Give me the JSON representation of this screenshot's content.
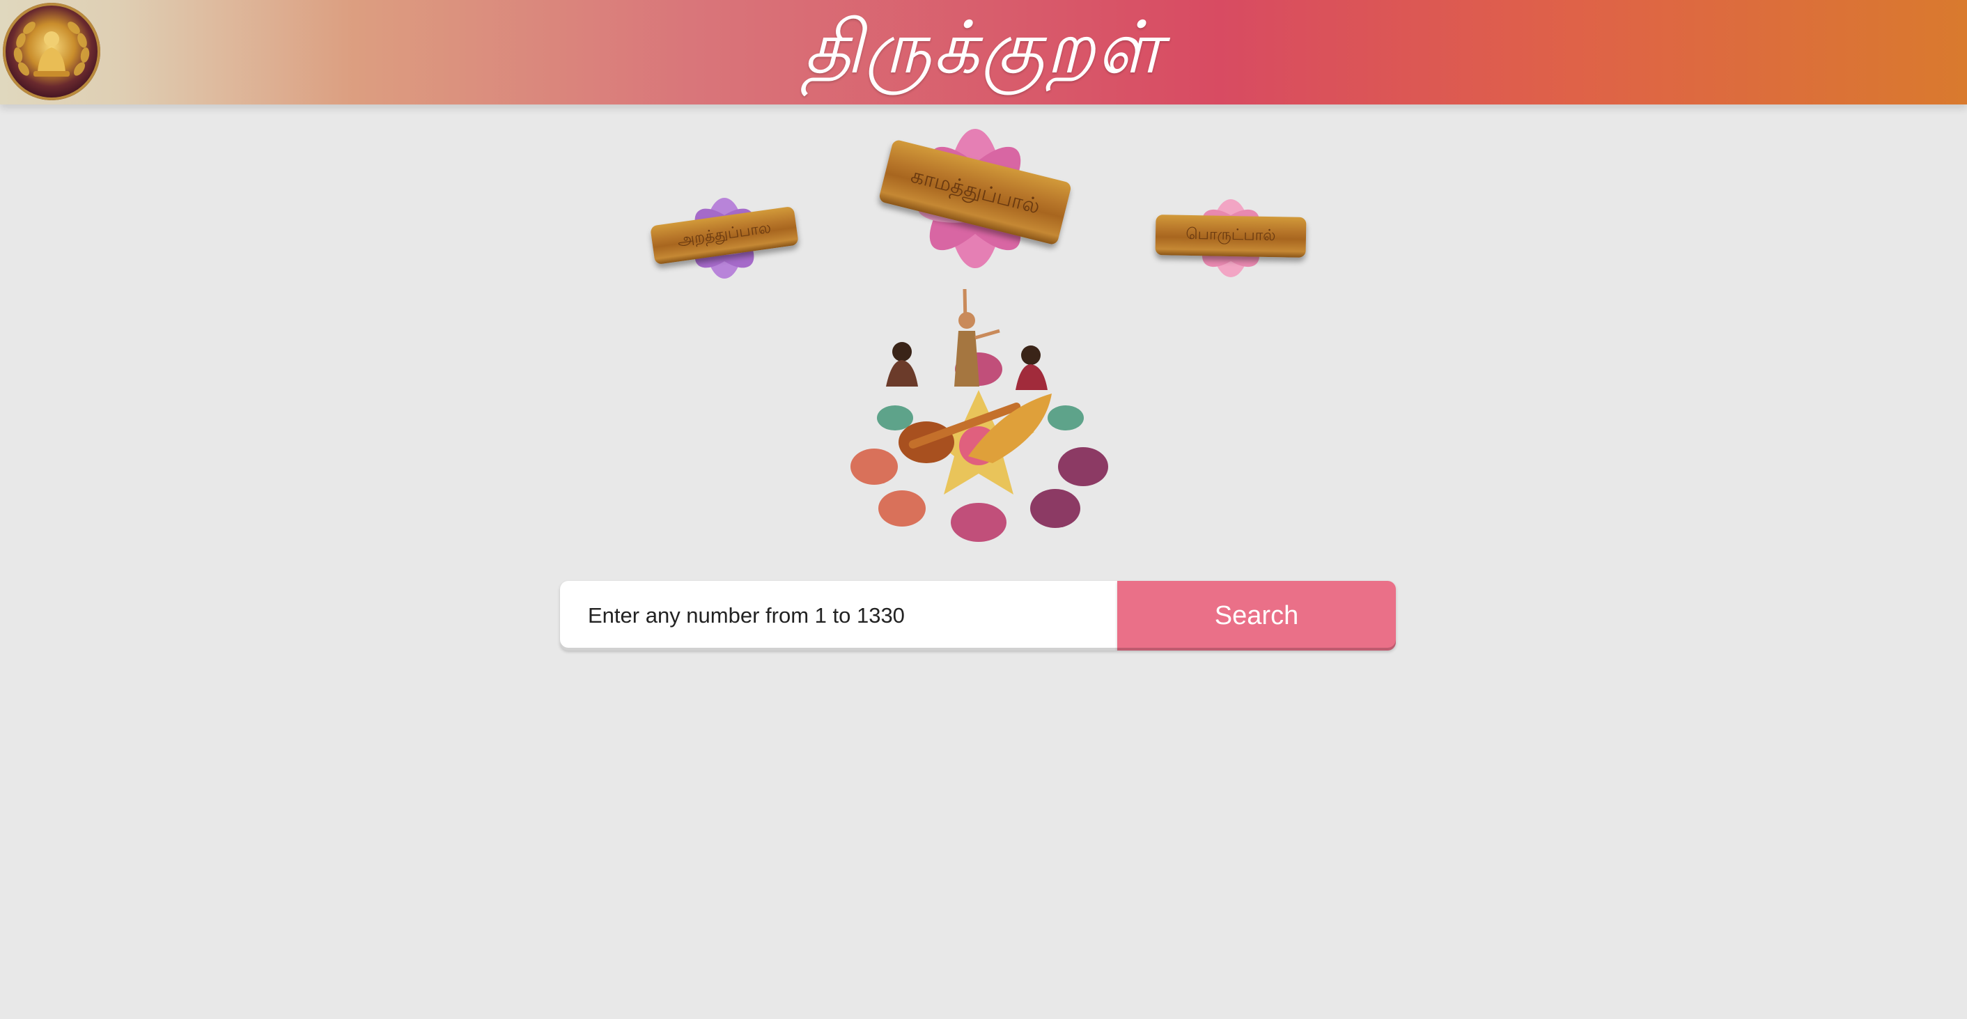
{
  "header": {
    "title": "திருக்குறள்",
    "logo_icon": "thiruvalluvar-seal-icon"
  },
  "sections": [
    {
      "label": "அறத்துப்பால",
      "flower_color": "#b884d9"
    },
    {
      "label": "காமத்துப்பால்",
      "flower_color": "#e57fb4"
    },
    {
      "label": "பொருட்பால்",
      "flower_color": "#f2a5c4"
    }
  ],
  "illustration": {
    "icon": "dancer-musicians-rangoli-icon"
  },
  "search": {
    "placeholder": "Enter any number from 1 to 1330",
    "button_label": "Search"
  },
  "colors": {
    "accent": "#ea7088",
    "background": "#e8e8e8"
  }
}
